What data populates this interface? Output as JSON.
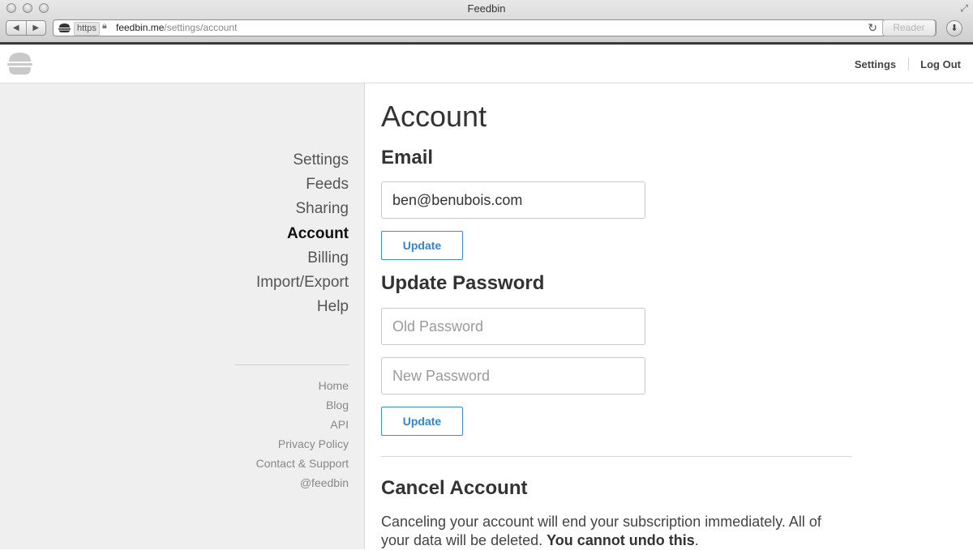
{
  "window": {
    "title": "Feedbin"
  },
  "toolbar": {
    "scheme": "https",
    "url_domain": "feedbin.me",
    "url_path": "/settings/account",
    "reader_label": "Reader"
  },
  "header": {
    "settings_label": "Settings",
    "logout_label": "Log Out"
  },
  "sidebar": {
    "nav": [
      {
        "label": "Settings"
      },
      {
        "label": "Feeds"
      },
      {
        "label": "Sharing"
      },
      {
        "label": "Account",
        "active": true
      },
      {
        "label": "Billing"
      },
      {
        "label": "Import/Export"
      },
      {
        "label": "Help"
      }
    ],
    "links": [
      {
        "label": "Home"
      },
      {
        "label": "Blog"
      },
      {
        "label": "API"
      },
      {
        "label": "Privacy Policy"
      },
      {
        "label": "Contact & Support"
      },
      {
        "label": "@feedbin"
      }
    ]
  },
  "main": {
    "title": "Account",
    "email": {
      "heading": "Email",
      "value": "ben@benubois.com",
      "button": "Update"
    },
    "password": {
      "heading": "Update Password",
      "old_placeholder": "Old Password",
      "new_placeholder": "New Password",
      "button": "Update"
    },
    "cancel": {
      "heading": "Cancel Account",
      "text": "Canceling your account will end your subscription immediately. All of your data will be deleted.",
      "emphasis": "You cannot undo this",
      "end": "."
    }
  },
  "colors": {
    "accent": "#2f86d4",
    "sidebar_bg": "#efefef"
  }
}
